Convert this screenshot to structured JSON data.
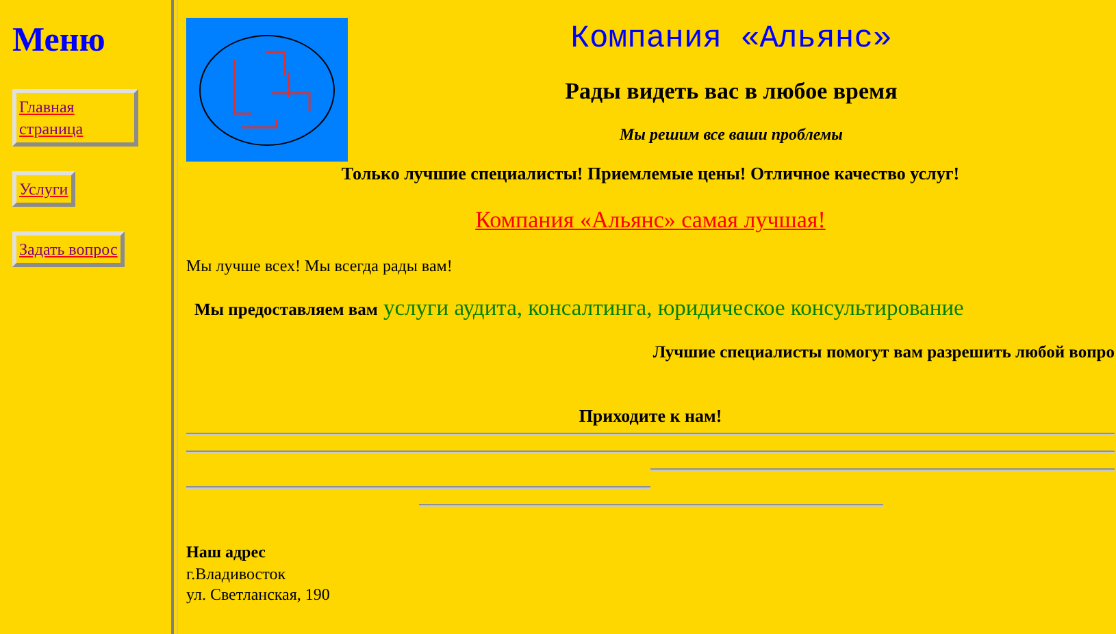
{
  "sidebar": {
    "title": "Меню",
    "items": [
      {
        "label": "Главная страница"
      },
      {
        "label": "Услуги"
      },
      {
        "label": "Задать вопрос"
      }
    ]
  },
  "header": {
    "title": "Компания «Альянс»",
    "subtitle": "Рады видеть вас в любое время",
    "tagline": "Мы решим все ваши проблемы"
  },
  "intro": "Только лучшие специалисты! Приемлемые цены! Отличное качество услуг!",
  "slogan": "Компания «Альянс» самая лучшая!",
  "greeting": "Мы лучше всех! Мы всегда рады вам!",
  "services": {
    "lead": "Мы предоставляем вам",
    "list": "услуги аудита, консалтинга, юридическое консультирование"
  },
  "help": "Лучшие специалисты помогут вам разрешить любой вопро",
  "invite": "Приходите к нам!",
  "address": {
    "heading": "Наш адрес",
    "lines": [
      "г.Владивосток",
      "ул. Светланская, 190"
    ]
  }
}
